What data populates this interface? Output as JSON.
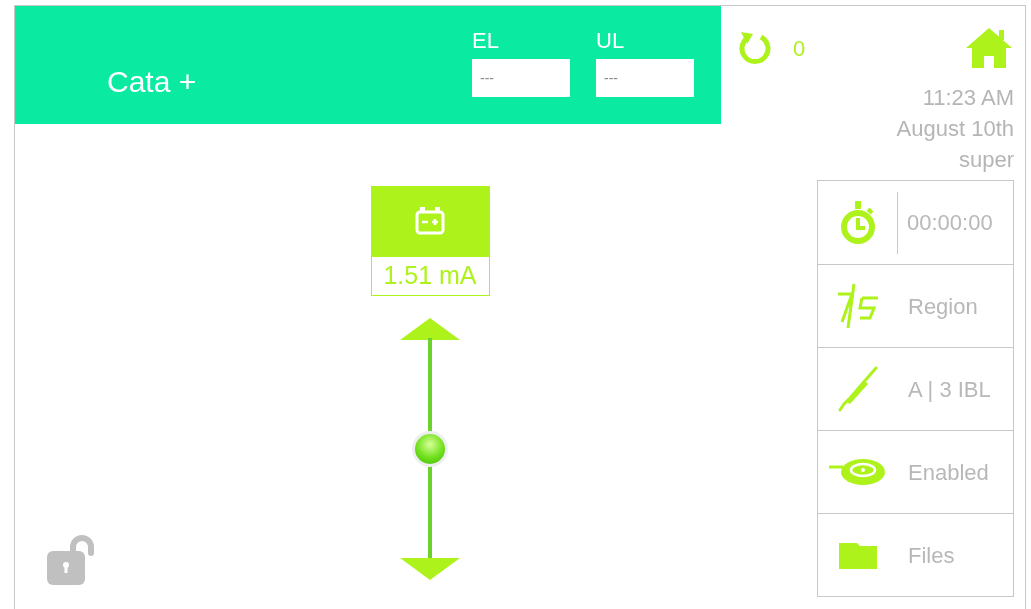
{
  "header": {
    "title": "Cata +",
    "fields": [
      {
        "label": "EL",
        "placeholder": "---"
      },
      {
        "label": "UL",
        "placeholder": "---"
      }
    ]
  },
  "counter": {
    "value": "0"
  },
  "clock": {
    "time": "11:23 AM",
    "date": "August 10th",
    "user": "super"
  },
  "current": {
    "reading": "1.51 mA"
  },
  "slider": {
    "level": 0.5
  },
  "lock": {
    "locked": false
  },
  "menu": [
    {
      "kind": "timer",
      "label": "00:00:00"
    },
    {
      "kind": "region",
      "label": "Region"
    },
    {
      "kind": "probe",
      "label": "A | 3 IBL"
    },
    {
      "kind": "pad",
      "label": "Enabled"
    },
    {
      "kind": "files",
      "label": "Files"
    }
  ]
}
